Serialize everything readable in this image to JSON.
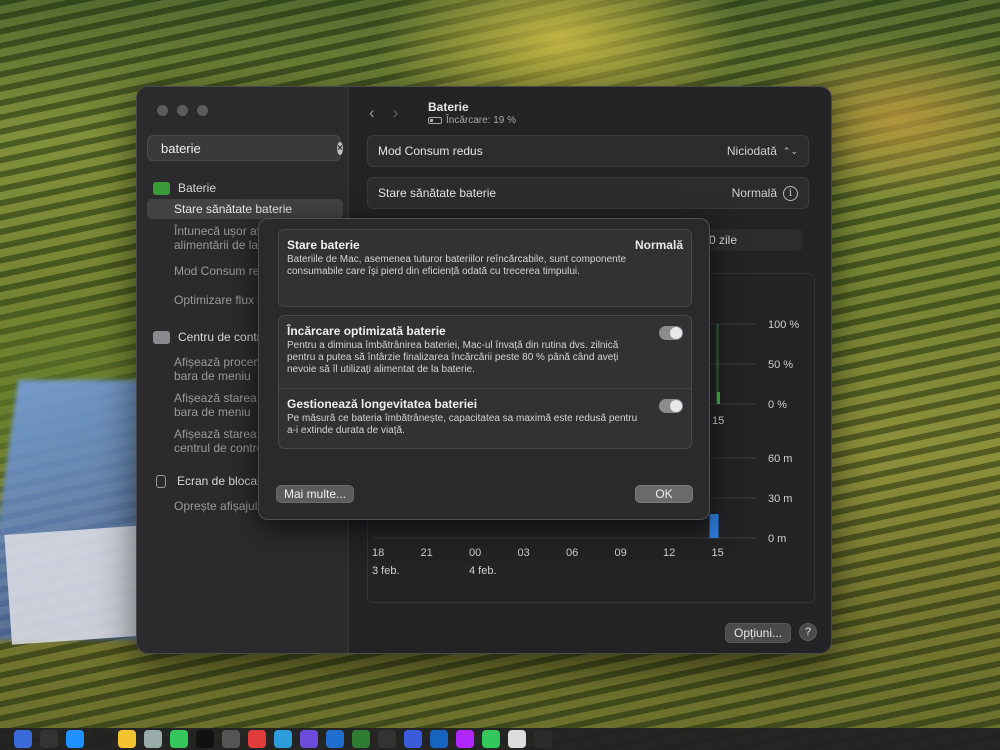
{
  "sidebar": {
    "search": {
      "value": "baterie"
    },
    "categories": [
      {
        "label": "Baterie",
        "icon": "battery-icon",
        "items": [
          {
            "label": "Stare sănătate baterie",
            "selected": true
          },
          {
            "label": "Întunecă ușor afișajul în timpul alimentării de la baterie"
          },
          {
            "label": "Mod Consum redus"
          },
          {
            "label": "Optimizare flux video"
          }
        ]
      },
      {
        "label": "Centru de control",
        "icon": "control-center-icon",
        "items": [
          {
            "label": "Afișează procentul bateriei în bara de meniu"
          },
          {
            "label": "Afișează starea bateriei în bara de meniu"
          },
          {
            "label": "Afișează starea bateriei în centrul de control"
          }
        ]
      },
      {
        "label": "Ecran de blocare",
        "icon": "lock-icon",
        "items": [
          {
            "label": "Oprește afișajul la inactivitate"
          }
        ]
      }
    ]
  },
  "header": {
    "title": "Baterie",
    "subtitle": "Încărcare: 19 %"
  },
  "settings": {
    "low_power": {
      "label": "Mod Consum redus",
      "value": "Niciodată"
    },
    "health": {
      "label": "Stare sănătate baterie",
      "value": "Normală"
    },
    "partial_tab": "0 zile"
  },
  "chart_data": [
    {
      "type": "bar",
      "y_ticks": [
        "100 %",
        "50 %",
        "0 %"
      ],
      "x_ticks": [
        "15"
      ],
      "ylim": [
        0,
        100
      ]
    },
    {
      "type": "bar",
      "y_ticks": [
        "60 m",
        "30 m",
        "0 m"
      ],
      "x_ticks": [
        "18",
        "21",
        "00",
        "03",
        "06",
        "09",
        "12",
        "15"
      ],
      "date_labels": [
        "3 feb.",
        "4 feb."
      ],
      "ylim": [
        0,
        60
      ],
      "bars": [
        {
          "x": "15",
          "value": 18
        }
      ]
    }
  ],
  "footer": {
    "options_label": "Opțiuni...",
    "help_label": "?"
  },
  "dialog": {
    "status": {
      "title": "Stare baterie",
      "value": "Normală",
      "description": "Bateriile de Mac, asemenea tuturor bateriilor reîncărcabile, sunt componente consumabile care își pierd din eficiență odată cu trecerea timpului."
    },
    "optimized": {
      "title": "Încărcare optimizată baterie",
      "description": "Pentru a diminua îmbătrânirea bateriei, Mac-ul învață din rutina dvs. zilnică pentru a putea să întârzie finalizarea încărcării peste 80 % până când aveți nevoie să îl utilizați alimentat de la baterie.",
      "enabled": true
    },
    "longevity": {
      "title": "Gestionează longevitatea bateriei",
      "description": "Pe măsură ce bateria îmbătrânește, capacitatea sa maximă este redusă pentru a-i extinde durata de viață.",
      "enabled": true
    },
    "more_label": "Mai multe...",
    "ok_label": "OK"
  },
  "colors": {
    "accent_blue": "#2f7fe0",
    "battery_green": "#4caf50"
  }
}
